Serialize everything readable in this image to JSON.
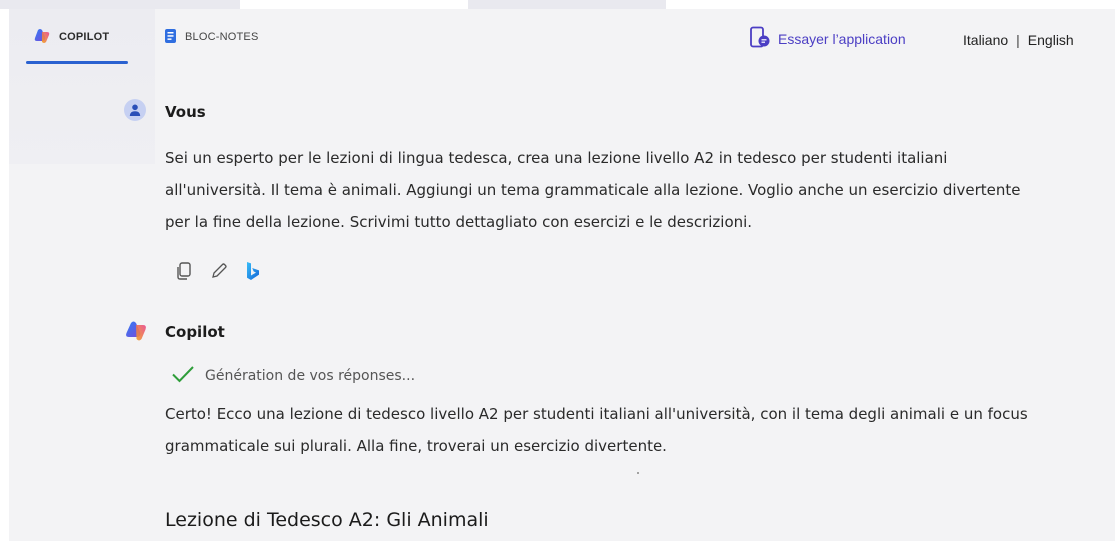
{
  "header": {
    "tabs": [
      {
        "label": "COPILOT",
        "icon": "copilot-logo-icon",
        "active": true
      },
      {
        "label": "BLOC-NOTES",
        "icon": "notebook-icon",
        "active": false
      }
    ],
    "app_link": {
      "label": "Essayer l’application",
      "icon": "phone-app-icon"
    },
    "languages": [
      "Italiano",
      "English"
    ],
    "language_separator": "|"
  },
  "conversation": {
    "user": {
      "name": "Vous",
      "lines": [
        "Sei un esperto per le lezioni di lingua tedesca, crea una lezione livello A2 in tedesco per studenti italiani",
        "all'università. Il tema è animali. Aggiungi un tema grammaticale alla lezione. Voglio anche un esercizio divertente",
        "per la fine della lezione. Scrivimi tutto dettagliato con esercizi e le descrizioni."
      ],
      "actions": [
        "copy-icon",
        "edit-icon",
        "bing-icon"
      ]
    },
    "assistant": {
      "name": "Copilot",
      "status": "Génération de vos réponses...",
      "lines": [
        "Certo! Ecco una lezione di tedesco livello A2 per studenti italiani all'università, con il tema degli animali e un focus",
        "grammaticale sui plurali. Alla fine, troverai un esercizio divertente."
      ],
      "heading": "Lezione di Tedesco A2: Gli Animali"
    }
  },
  "colors": {
    "accent_underline": "#2a61d0",
    "app_link": "#4b3ec4",
    "check": "#2e9d3a",
    "background": "#f3f3f5"
  }
}
